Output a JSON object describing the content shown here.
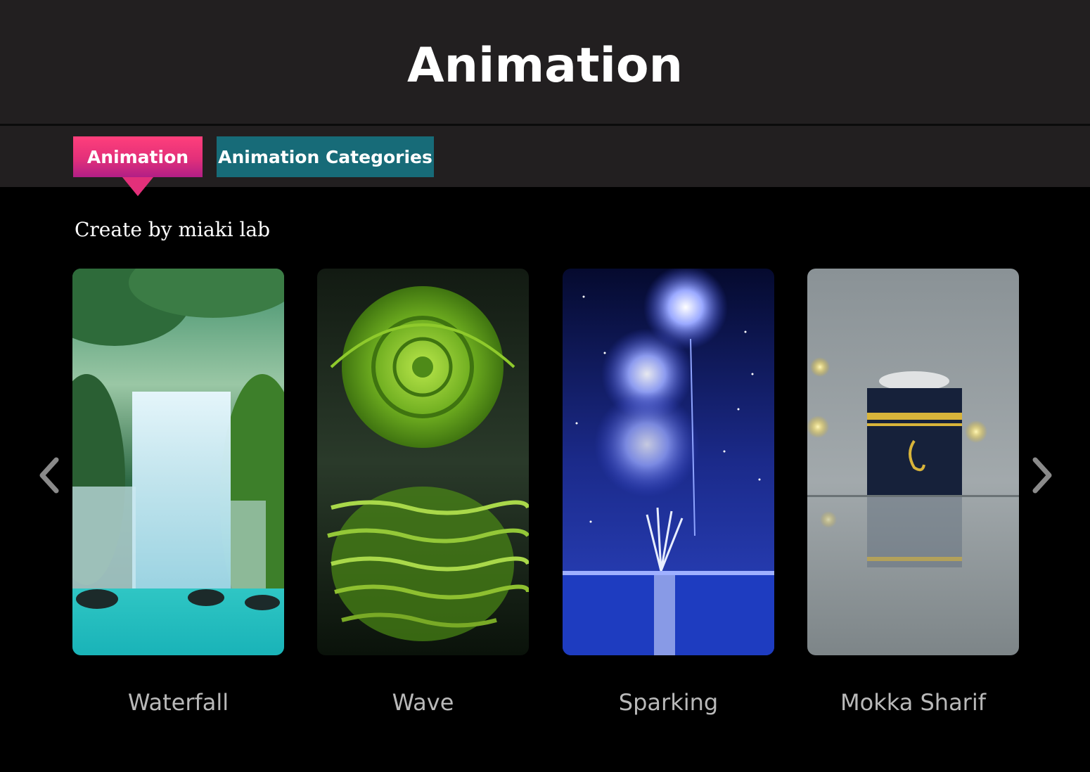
{
  "header": {
    "title": "Animation"
  },
  "tabs": [
    {
      "label": "Animation",
      "active": true,
      "color": "#e3307a"
    },
    {
      "label": "Animation Categories",
      "active": false,
      "color": "#176b78"
    }
  ],
  "subtitle": "Create by miaki lab",
  "carousel": {
    "prev_icon": "chevron-left-icon",
    "next_icon": "chevron-right-icon",
    "items": [
      {
        "label": "Waterfall"
      },
      {
        "label": "Wave"
      },
      {
        "label": "Sparking"
      },
      {
        "label": "Mokka Sharif"
      }
    ]
  }
}
